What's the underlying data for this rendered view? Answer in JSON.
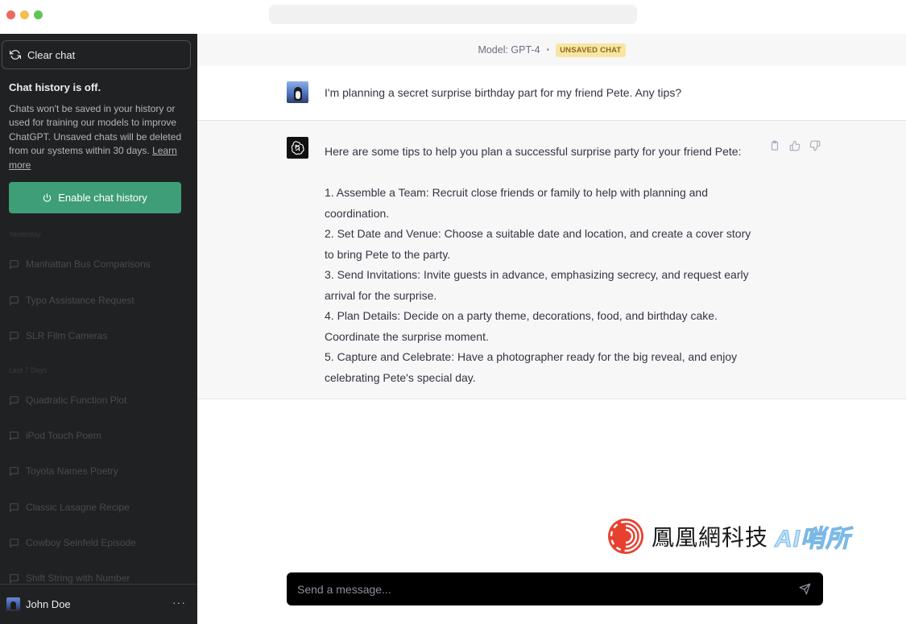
{
  "sidebar": {
    "clear_chat_label": "Clear chat",
    "history_off_title": "Chat history is off.",
    "history_off_desc": "Chats won't be saved in your history or used for training our models to improve ChatGPT. Unsaved chats will be deleted from our systems within 30 days.",
    "learn_more": "Learn more",
    "enable_label": "Enable chat history",
    "sections": [
      {
        "label": "Yesterday",
        "items": [
          "Manhattan Bus Comparisons",
          "Typo Assistance Request",
          "SLR Film Cameras"
        ]
      },
      {
        "label": "Last 7 Days",
        "items": [
          "Quadratic Function Plot",
          "iPod Touch Poem",
          "Toyota Names Poetry",
          "Classic Lasagne Recipe",
          "Cowboy Seinfeld Episode",
          "Shift String with Number"
        ]
      }
    ],
    "user_name": "John Doe",
    "more_label": "···"
  },
  "main": {
    "model_label": "Model: GPT-4",
    "model_sep": "•",
    "unsaved_badge": "UNSAVED CHAT",
    "user_message": "I'm planning a secret surprise birthday part for my friend Pete. Any tips?",
    "bot_intro": "Here are some tips to help you plan a successful surprise party for your friend Pete:",
    "bot_points": [
      "1. Assemble a Team: Recruit close friends or family to help with planning and coordination.",
      "2. Set Date and Venue: Choose a suitable date and location, and create a cover story to bring Pete to the party.",
      "3. Send Invitations: Invite guests in advance, emphasizing secrecy, and request early arrival for the surprise.",
      "4. Plan Details: Decide on a party theme, decorations, food, and birthday cake. Coordinate the surprise moment.",
      "5. Capture and Celebrate: Have a photographer ready for the big reveal, and enjoy celebrating Pete's special day."
    ],
    "input_placeholder": "Send a message..."
  },
  "watermark": {
    "text": "鳳凰網科技",
    "ai_text": "AI哨所"
  },
  "icons": {
    "clear": "refresh-icon",
    "power": "power-icon",
    "chat": "chat-bubble-icon",
    "copy": "clipboard-icon",
    "like": "thumbs-up-icon",
    "dislike": "thumbs-down-icon",
    "send": "send-icon",
    "bot": "openai-logo-icon"
  },
  "colors": {
    "sidebar_bg": "#202123",
    "enable_button": "#3e9e77",
    "badge_bg": "#f9e5a3",
    "input_bg": "#000000"
  }
}
